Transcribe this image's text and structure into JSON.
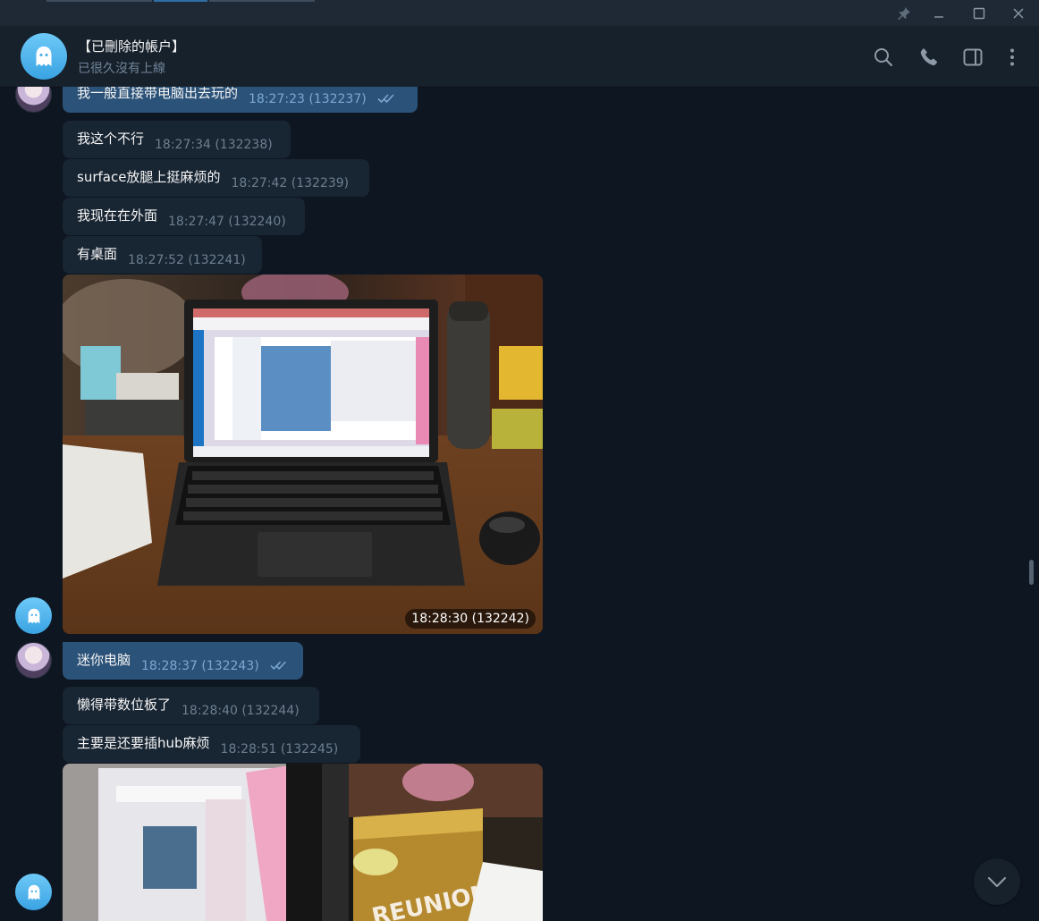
{
  "header": {
    "name": "【已刪除的帳户】",
    "status": "已很久沒有上線"
  },
  "messages": [
    {
      "text": "我一般直接带电脑出去玩的",
      "time": "18:27:23 (132237)",
      "outgoing": true
    },
    {
      "text": "我这个不行",
      "time": "18:27:34 (132238)",
      "outgoing": false
    },
    {
      "text": "surface放腿上挺麻烦的",
      "time": "18:27:42 (132239)",
      "outgoing": false
    },
    {
      "text": "我现在在外面",
      "time": "18:27:47 (132240)",
      "outgoing": false
    },
    {
      "text": "有桌面",
      "time": "18:27:52 (132241)",
      "outgoing": false
    },
    {
      "photo_time": "18:28:30 (132242)",
      "outgoing": false
    },
    {
      "text": "迷你电脑",
      "time": "18:28:37 (132243)",
      "outgoing": true
    },
    {
      "text": "懒得带数位板了",
      "time": "18:28:40 (132244)",
      "outgoing": false
    },
    {
      "text": "主要是还要插hub麻烦",
      "time": "18:28:51 (132245)",
      "outgoing": false
    }
  ],
  "photo2_text": "REUNION",
  "colors": {
    "background": "#0e1621",
    "header": "#17212b",
    "incoming_bubble": "#182533",
    "outgoing_bubble": "#2b5278",
    "avatar_ghost": "#3aa3e3"
  },
  "icons": [
    "pin-icon",
    "minimize-icon",
    "maximize-icon",
    "close-icon",
    "ghost-icon",
    "search-icon",
    "phone-icon",
    "sidebar-icon",
    "more-icon",
    "read-ticks-icon",
    "chevron-down-icon"
  ]
}
